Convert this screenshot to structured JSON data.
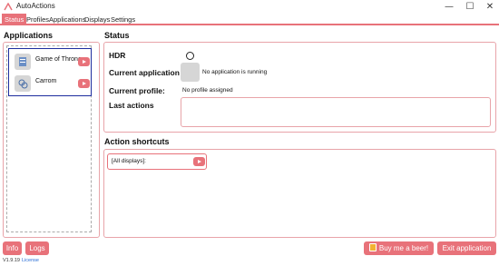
{
  "window": {
    "title": "AutoActions",
    "minimize_glyph": "—",
    "maximize_glyph": "☐",
    "close_glyph": "✕",
    "app_icon": "autoactions-logo-icon"
  },
  "menu": {
    "items": [
      {
        "label": "Status",
        "active": true
      },
      {
        "label": "Profiles",
        "active": false
      },
      {
        "label": "Applications",
        "active": false
      },
      {
        "label": "Displays",
        "active": false
      },
      {
        "label": "Settings",
        "active": false
      }
    ]
  },
  "applications": {
    "heading": "Applications",
    "items": [
      {
        "label": "Game of Thrones",
        "icon": "app-icon"
      },
      {
        "label": "Carrom",
        "icon": "app-icon"
      }
    ]
  },
  "status": {
    "heading": "Status",
    "hdr_label": "HDR",
    "current_application_label": "Current application",
    "current_application_value": "No application is running",
    "current_profile_label": "Current profile:",
    "current_profile_value": "No profile assigned",
    "last_actions_label": "Last actions"
  },
  "shortcuts": {
    "heading": "Action shortcuts",
    "items": [
      {
        "label": "[All displays]:"
      }
    ]
  },
  "footer": {
    "info_label": "Info",
    "logs_label": "Logs",
    "beer_label": "Buy me a beer!",
    "exit_label": "Exit application",
    "version": "V1.9.19",
    "license": "License"
  },
  "colors": {
    "accent": "#e8727a",
    "selection": "#1d2d9e"
  }
}
